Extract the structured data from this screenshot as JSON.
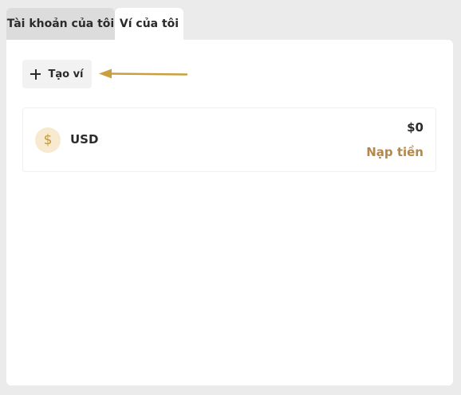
{
  "tabs": [
    {
      "label": "Tài khoản của tôi",
      "active": false
    },
    {
      "label": "Ví của tôi",
      "active": true
    }
  ],
  "toolbar": {
    "create_wallet_label": "Tạo ví",
    "create_wallet_icon": "plus-icon"
  },
  "wallets": [
    {
      "currency": "USD",
      "icon": "dollar-coin-icon",
      "icon_glyph": "$",
      "balance": "$0",
      "deposit_label": "Nạp tiền"
    }
  ],
  "colors": {
    "accent": "#b5884a",
    "arrow": "#c9a03e",
    "coin_bg": "#f7ead1",
    "coin_fg": "#c8973a"
  }
}
